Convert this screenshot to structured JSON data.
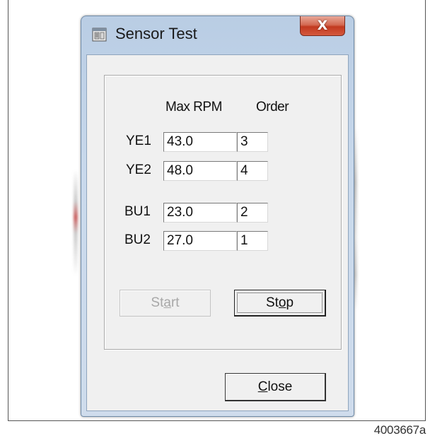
{
  "window": {
    "title": "Sensor Test",
    "close_glyph": "X",
    "icon": "app-window-icon"
  },
  "table": {
    "headers": {
      "max_rpm": "Max RPM",
      "order": "Order"
    },
    "rows": [
      {
        "label": "YE1",
        "max_rpm": "43.0",
        "order": "3"
      },
      {
        "label": "YE2",
        "max_rpm": "48.0",
        "order": "4"
      },
      {
        "label": "BU1",
        "max_rpm": "23.0",
        "order": "2"
      },
      {
        "label": "BU2",
        "max_rpm": "27.0",
        "order": "1"
      }
    ]
  },
  "buttons": {
    "start": {
      "pre": "St",
      "accel": "a",
      "post": "rt",
      "enabled": false
    },
    "stop": {
      "pre": "St",
      "accel": "o",
      "post": "p",
      "enabled": true
    },
    "close": {
      "pre": "",
      "accel": "C",
      "post": "lose",
      "enabled": true
    }
  },
  "figure_id": "4003667a",
  "colors": {
    "close_button_red": "#c2391f",
    "titlebar_blue": "#b9cde4",
    "disabled_text": "#a8a8a8"
  }
}
